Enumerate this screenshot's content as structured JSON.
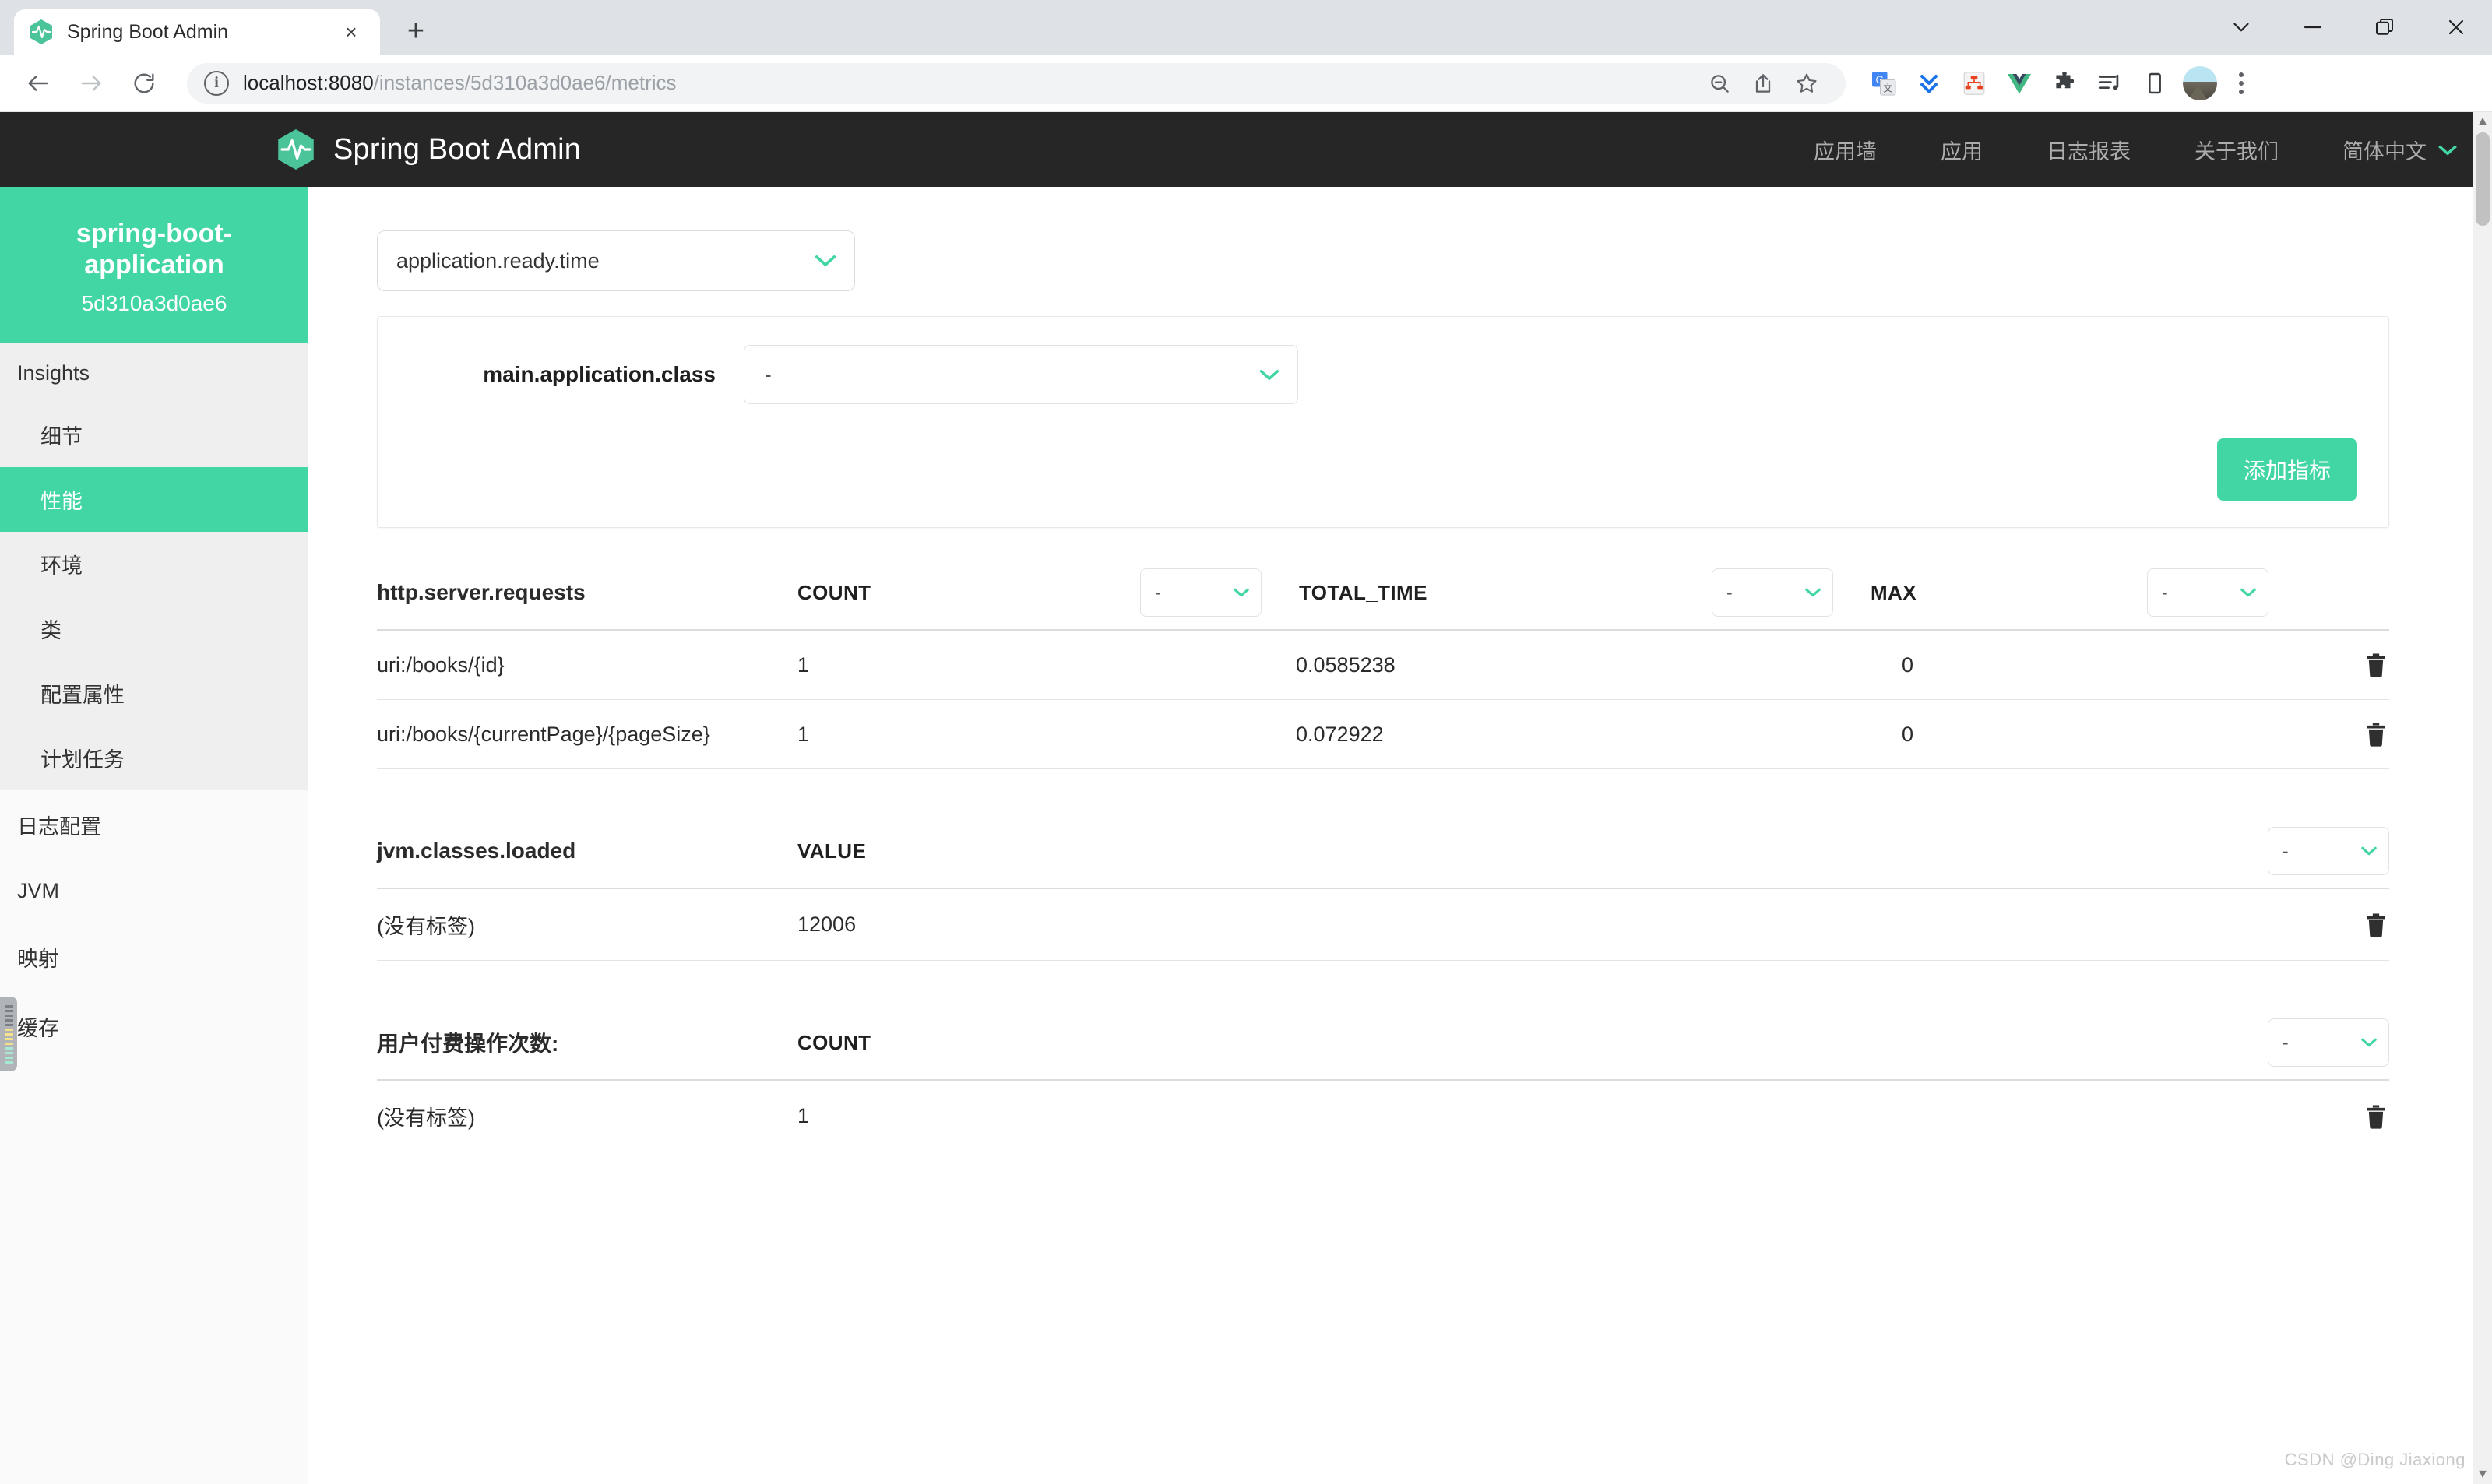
{
  "browser": {
    "tab": {
      "title": "Spring Boot Admin",
      "favicon": "spring-boot-admin-icon",
      "close": "×"
    },
    "new_tab": "+",
    "window": {
      "minimize": "—",
      "restore": "restore",
      "close": "✕",
      "tab_search": "∨"
    },
    "nav": {
      "back": "←",
      "forward": "→",
      "reload": "↻"
    },
    "omnibox": {
      "info_icon": "site-info-icon",
      "url_host": "localhost:8080",
      "url_path": "/instances/5d310a3d0ae6/metrics",
      "zoom_out_icon": "zoom-out-icon",
      "share_icon": "share-icon",
      "bookmark_icon": "star-icon"
    },
    "extensions": [
      {
        "name": "google-translate-icon"
      },
      {
        "name": "download-chevrons-icon"
      },
      {
        "name": "sitemap-icon"
      },
      {
        "name": "vue-devtools-icon"
      },
      {
        "name": "extensions-puzzle-icon"
      },
      {
        "name": "playlist-icon"
      },
      {
        "name": "device-toolbar-icon"
      }
    ],
    "profile": "avatar",
    "menu": "chrome-menu-icon"
  },
  "app": {
    "brand": "Spring Boot Admin",
    "brand_color": "#42d6a4",
    "header_bg": "#262626",
    "nav": [
      {
        "label": "应用墙"
      },
      {
        "label": "应用"
      },
      {
        "label": "日志报表"
      },
      {
        "label": "关于我们"
      }
    ],
    "language": {
      "label": "简体中文",
      "chevron": "⌄"
    }
  },
  "sidebar": {
    "instance_name": "spring-boot-application",
    "instance_id": "5d310a3d0ae6",
    "group_title": "Insights",
    "group_items": [
      {
        "label": "细节",
        "active": false
      },
      {
        "label": "性能",
        "active": true
      },
      {
        "label": "环境",
        "active": false
      },
      {
        "label": "类",
        "active": false
      },
      {
        "label": "配置属性",
        "active": false
      },
      {
        "label": "计划任务",
        "active": false
      }
    ],
    "flat_items": [
      {
        "label": "日志配置"
      },
      {
        "label": "JVM"
      },
      {
        "label": "映射"
      },
      {
        "label": "缓存"
      }
    ]
  },
  "main": {
    "metric_select": {
      "value": "application.ready.time",
      "chevron": "⌄"
    },
    "card": {
      "tag_label": "main.application.class",
      "tag_value": "-",
      "tag_chevron": "⌄",
      "add_button": "添加指标"
    },
    "sections": [
      {
        "name": "http.server.requests",
        "columns": [
          {
            "label": "COUNT",
            "select": "-",
            "chevron": "⌄"
          },
          {
            "label": "TOTAL_TIME",
            "select": "-",
            "chevron": "⌄"
          },
          {
            "label": "MAX",
            "select": "-",
            "chevron": "⌄"
          }
        ],
        "rows": [
          {
            "name": "uri:/books/{id}",
            "values": [
              "1",
              "0.0585238",
              "0"
            ],
            "delete": "trash-icon"
          },
          {
            "name": "uri:/books/{currentPage}/{pageSize}",
            "values": [
              "1",
              "0.072922",
              "0"
            ],
            "delete": "trash-icon"
          }
        ]
      },
      {
        "name": "jvm.classes.loaded",
        "columns": [
          {
            "label": "VALUE",
            "select": "-",
            "chevron": "⌄"
          }
        ],
        "rows": [
          {
            "name": "(没有标签)",
            "values": [
              "12006"
            ],
            "delete": "trash-icon"
          }
        ]
      },
      {
        "name": "用户付费操作次数:",
        "columns": [
          {
            "label": "COUNT",
            "select": "-",
            "chevron": "⌄"
          }
        ],
        "rows": [
          {
            "name": "(没有标签)",
            "values": [
              "1"
            ],
            "delete": "trash-icon"
          }
        ]
      }
    ],
    "watermark": "CSDN @Ding Jiaxiong"
  }
}
